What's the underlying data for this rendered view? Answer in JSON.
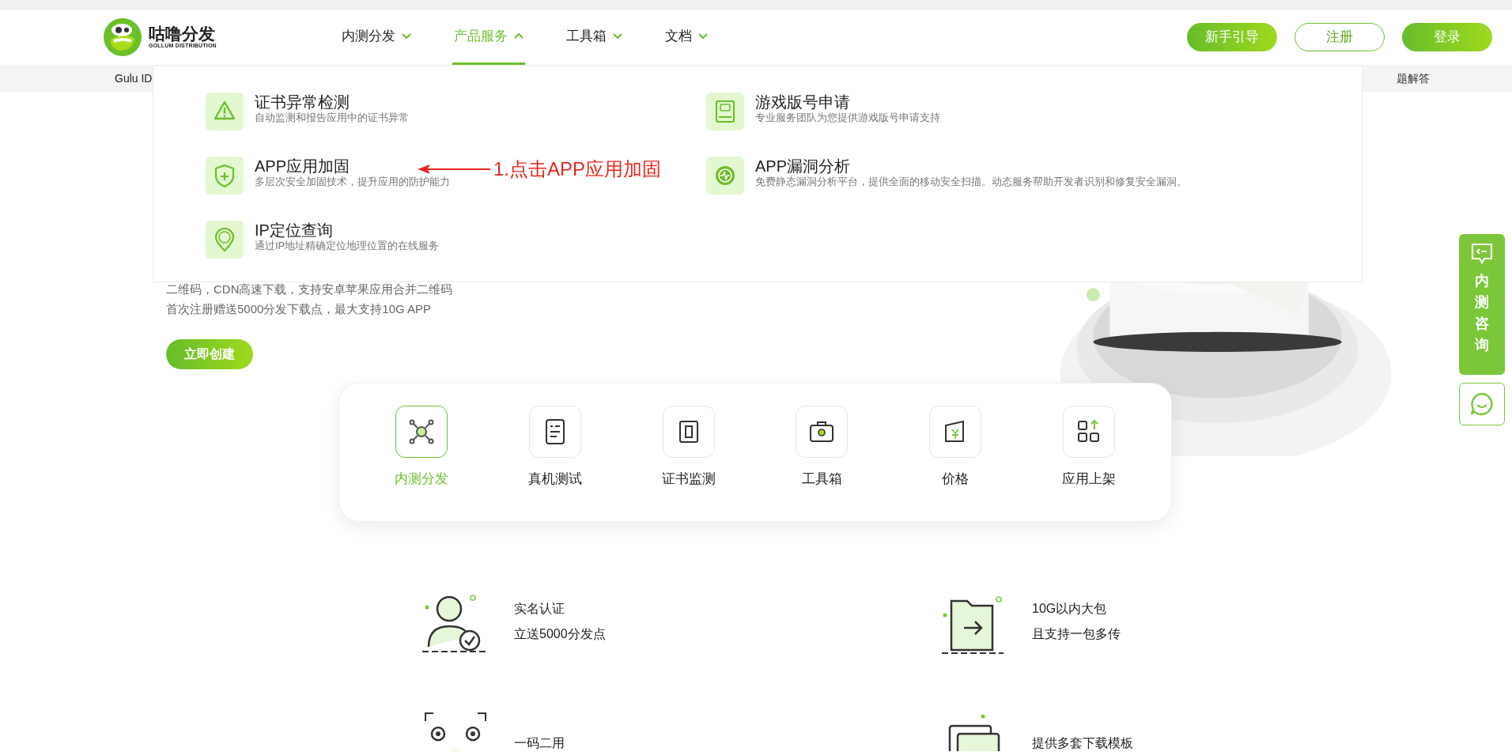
{
  "logo": {
    "name": "咕噜分发",
    "subtitle": "GOLLUM DISTRIBUTION"
  },
  "nav": [
    {
      "label": "内测分发",
      "selected": false,
      "expanded": false
    },
    {
      "label": "产品服务",
      "selected": true,
      "expanded": true
    },
    {
      "label": "工具箱",
      "selected": false,
      "expanded": false
    },
    {
      "label": "文档",
      "selected": false,
      "expanded": false
    }
  ],
  "header_buttons": [
    {
      "label": "新手引导",
      "kind": "filled"
    },
    {
      "label": "注册",
      "kind": "outline"
    },
    {
      "label": "登录",
      "kind": "filled"
    }
  ],
  "subbar": {
    "left": "Gulu ID",
    "links": [
      "题解答"
    ]
  },
  "dropdown": [
    {
      "title": "证书异常检测",
      "description": "自动监测和报告应用中的证书异常"
    },
    {
      "title": "游戏版号申请",
      "description": "专业服务团队为您提供游戏版号申请支持"
    },
    {
      "title": "APP应用加固",
      "description": "多层次安全加固技术，提升应用的防护能力"
    },
    {
      "title": "APP漏洞分析",
      "description": "免费静态漏洞分析平台，提供全面的移动安全扫描。动态服务帮助开发者识别和修复安全漏洞。"
    },
    {
      "title": "IP定位查询",
      "description": "通过IP地址精确定位地理位置的在线服务"
    }
  ],
  "annotation": {
    "text": "1.点击APP应用加固"
  },
  "hero": {
    "lines": [
      "二维码，CDN高速下载，支持安卓苹果应用合并二维码",
      "首次注册赠送5000分发下载点，最大支持10G APP"
    ],
    "button": "立即创建"
  },
  "features": [
    {
      "label": "内测分发",
      "selected": true
    },
    {
      "label": "真机测试",
      "selected": false
    },
    {
      "label": "证书监测",
      "selected": false
    },
    {
      "label": "工具箱",
      "selected": false
    },
    {
      "label": "价格",
      "selected": false
    },
    {
      "label": "应用上架",
      "selected": false
    }
  ],
  "highlights": [
    {
      "lines": [
        "实名认证",
        "立送5000分发点"
      ]
    },
    {
      "lines": [
        "10G以内大包",
        "且支持一包多传"
      ]
    },
    {
      "lines": [
        "一码二用"
      ]
    },
    {
      "lines": [
        "提供多套下载模板"
      ]
    }
  ],
  "side_widget": {
    "label": "内测咨询"
  }
}
